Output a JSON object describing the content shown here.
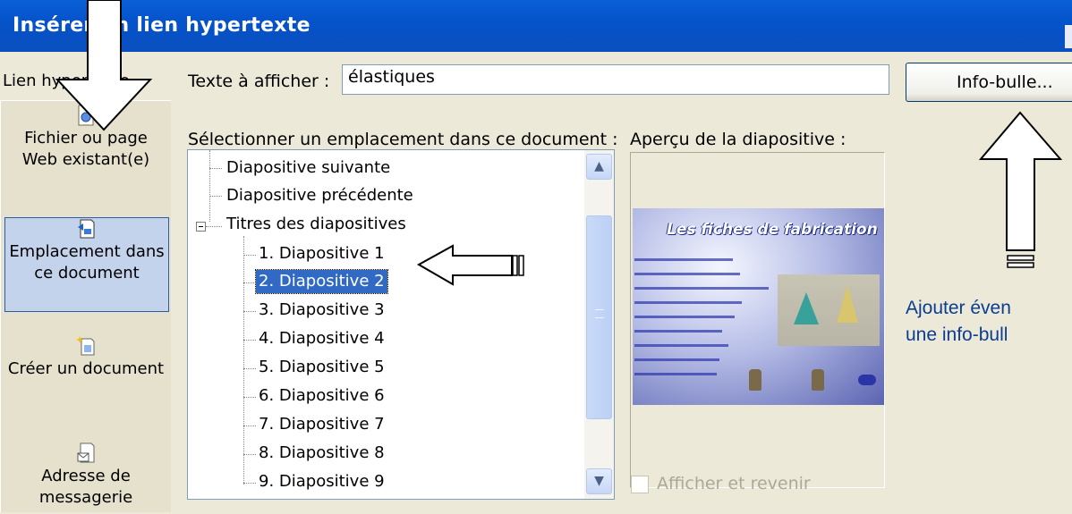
{
  "window": {
    "title": "Insérer un lien hypertexte"
  },
  "link_to": {
    "label": "Lien hypertexte"
  },
  "display_text": {
    "label": "Texte à afficher :",
    "value": "élastiques"
  },
  "tooltip_button": {
    "label": "Info-bulle..."
  },
  "sidebar": {
    "items": [
      {
        "label": "Fichier ou page Web existant(e)",
        "icon": "web-page-icon",
        "selected": false
      },
      {
        "label": "Emplacement dans ce document",
        "icon": "document-place-icon",
        "selected": true
      },
      {
        "label": "Créer un document",
        "icon": "new-document-icon",
        "selected": false
      },
      {
        "label": "Adresse de messagerie",
        "icon": "email-icon",
        "selected": false
      }
    ]
  },
  "location": {
    "label": "Sélectionner un emplacement dans ce document :",
    "tree": [
      {
        "label": "Diapositive suivante",
        "level": 0,
        "selected": false
      },
      {
        "label": "Diapositive précédente",
        "level": 0,
        "selected": false
      },
      {
        "label": "Titres des diapositives",
        "level": 0,
        "selected": false,
        "expanded": true
      },
      {
        "label": "1. Diapositive 1",
        "level": 1,
        "selected": false
      },
      {
        "label": "2. Diapositive 2",
        "level": 1,
        "selected": true
      },
      {
        "label": "3. Diapositive 3",
        "level": 1,
        "selected": false
      },
      {
        "label": "4. Diapositive 4",
        "level": 1,
        "selected": false
      },
      {
        "label": "5. Diapositive 5",
        "level": 1,
        "selected": false
      },
      {
        "label": "6. Diapositive 6",
        "level": 1,
        "selected": false
      },
      {
        "label": "7. Diapositive 7",
        "level": 1,
        "selected": false
      },
      {
        "label": "8. Diapositive 8",
        "level": 1,
        "selected": false
      },
      {
        "label": "9. Diapositive 9",
        "level": 1,
        "selected": false
      }
    ]
  },
  "preview": {
    "label": "Aperçu de la diapositive :",
    "slide_title": "Les fiches de fabrication",
    "show_and_return": {
      "label": "Afficher et revenir",
      "checked": false,
      "enabled": false
    }
  },
  "annotation": {
    "line1": "Ajouter éven",
    "line2": "une info-bull"
  },
  "colors": {
    "titlebar": "#0552c9",
    "selection": "#316ac5",
    "dialog_bg": "#ece9d8",
    "annotation_text": "#0b3d91"
  }
}
